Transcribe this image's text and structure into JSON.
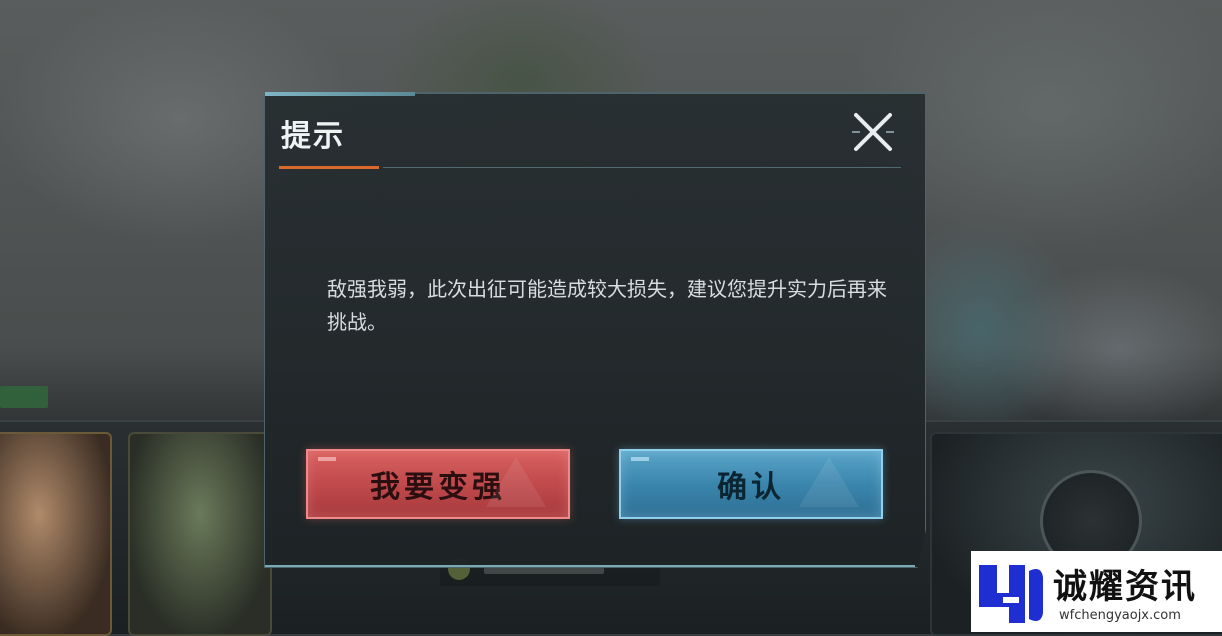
{
  "dialog": {
    "title": "提示",
    "message": "敌强我弱，此次出征可能造成较大损失，建议您提升实力后再来挑战。",
    "buttons": {
      "upgrade_label": "我要变强",
      "confirm_label": "确认"
    },
    "close_icon": "close-x-icon"
  },
  "watermark": {
    "name": "诚耀资讯",
    "url": "wfchengyaojx.com"
  },
  "colors": {
    "title_accent": "#d96a2c",
    "upgrade_button": "#c04a4c",
    "confirm_button": "#3b86ad"
  }
}
